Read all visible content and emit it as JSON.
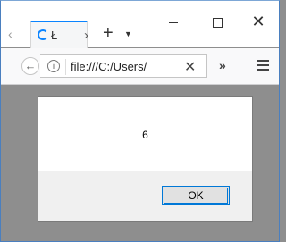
{
  "tab": {
    "title": "Ł"
  },
  "url": {
    "value": "file:///C:/Users/"
  },
  "dialog": {
    "message": "6",
    "ok_label": "OK"
  },
  "colors": {
    "accent": "#0a84ff",
    "button_border": "#0078d7",
    "content_bg": "#8e8e8e"
  },
  "icons": [
    "tab-scroll-left-icon",
    "spinner-icon",
    "tab-scroll-right-icon",
    "plus-icon",
    "chevron-down-icon",
    "minimize-icon",
    "maximize-icon",
    "close-icon",
    "back-icon",
    "info-icon",
    "clear-icon",
    "overflow-icon",
    "menu-icon"
  ]
}
